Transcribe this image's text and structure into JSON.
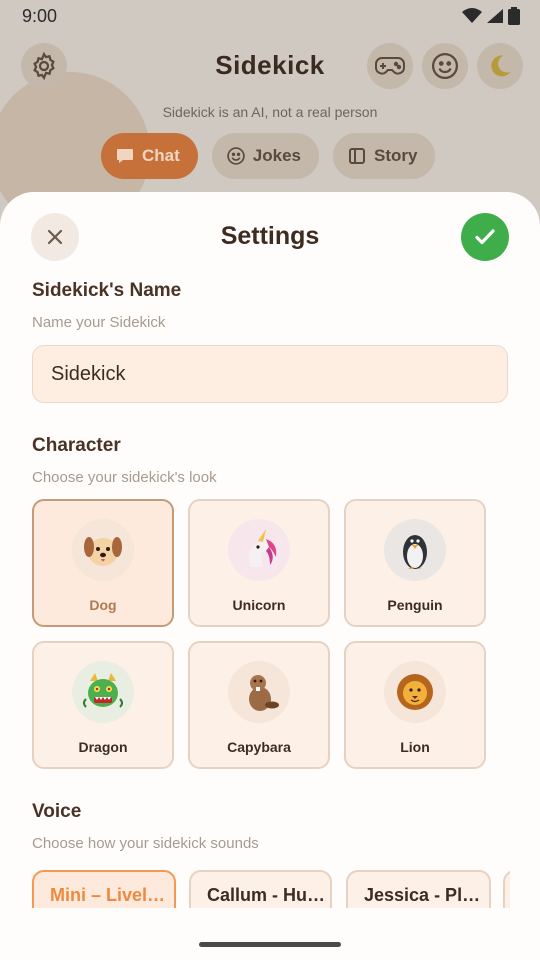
{
  "status_bar": {
    "time": "9:00"
  },
  "background_app": {
    "title": "Sidekick",
    "disclaimer": "Sidekick is an AI, not a real person",
    "tabs": [
      {
        "label": "Chat",
        "icon": "chat-bubble-icon",
        "active": true
      },
      {
        "label": "Jokes",
        "icon": "smiley-icon",
        "active": false
      },
      {
        "label": "Story",
        "icon": "book-icon",
        "active": false
      }
    ],
    "header_icons": [
      "gear-icon",
      "gamepad-icon",
      "smiley-icon",
      "moon-icon"
    ]
  },
  "settings": {
    "title": "Settings",
    "name_section": {
      "label": "Sidekick's Name",
      "sublabel": "Name your Sidekick",
      "value": "Sidekick"
    },
    "character_section": {
      "label": "Character",
      "sublabel": "Choose your sidekick's look",
      "options": [
        {
          "label": "Dog",
          "icon": "dog-icon",
          "selected": true
        },
        {
          "label": "Unicorn",
          "icon": "unicorn-icon",
          "selected": false
        },
        {
          "label": "Penguin",
          "icon": "penguin-icon",
          "selected": false
        },
        {
          "label": "Dragon",
          "icon": "dragon-icon",
          "selected": false
        },
        {
          "label": "Capybara",
          "icon": "capybara-icon",
          "selected": false
        },
        {
          "label": "Lion",
          "icon": "lion-icon",
          "selected": false
        }
      ]
    },
    "voice_section": {
      "label": "Voice",
      "sublabel": "Choose how your sidekick sounds",
      "options": [
        {
          "label": "Mini – Livel…",
          "selected": true
        },
        {
          "label": "Callum - Hu…",
          "selected": false
        },
        {
          "label": "Jessica - Pl…",
          "selected": false
        }
      ]
    }
  },
  "colors": {
    "accent_orange": "#ee8a3f",
    "confirm_green": "#3fae4a",
    "active_tab": "#c6703a"
  }
}
